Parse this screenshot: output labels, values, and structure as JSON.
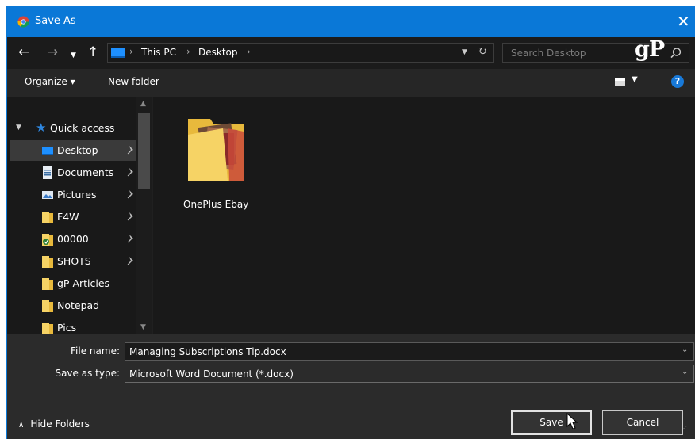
{
  "window": {
    "title": "Save As",
    "app_icon": "chrome-icon",
    "close_icon": "close-icon"
  },
  "nav": {
    "back_icon": "back-arrow-icon",
    "forward_icon": "forward-arrow-icon",
    "recent_icon": "chevron-down-icon",
    "up_icon": "up-arrow-icon",
    "breadcrumbs": [
      "This PC",
      "Desktop"
    ],
    "separator": "›",
    "refresh_icon": "refresh-icon",
    "search_placeholder": "Search Desktop",
    "watermark": "gP"
  },
  "toolbar": {
    "organize_label": "Organize ▾",
    "new_folder_label": "New folder",
    "help_label": "?"
  },
  "sidebar": {
    "quick_access_label": "Quick access",
    "items": [
      {
        "label": "Desktop",
        "icon": "desktop-icon",
        "pinned": true,
        "selected": true
      },
      {
        "label": "Documents",
        "icon": "documents-icon",
        "pinned": true
      },
      {
        "label": "Pictures",
        "icon": "pictures-icon",
        "pinned": true
      },
      {
        "label": "F4W",
        "icon": "folder-icon",
        "pinned": true
      },
      {
        "label": "00000",
        "icon": "folder-sync-icon",
        "pinned": true
      },
      {
        "label": "SHOTS",
        "icon": "folder-icon",
        "pinned": true
      },
      {
        "label": "gP Articles",
        "icon": "folder-icon",
        "pinned": false
      },
      {
        "label": "Notepad",
        "icon": "folder-icon",
        "pinned": false
      },
      {
        "label": "Pics",
        "icon": "folder-icon",
        "pinned": false
      }
    ]
  },
  "content": {
    "items": [
      {
        "label": "OnePlus Ebay",
        "icon": "folder-with-images-icon"
      }
    ]
  },
  "form": {
    "file_name_label": "File name:",
    "file_name_value": "Managing Subscriptions Tip.docx",
    "save_as_type_label": "Save as type:",
    "save_as_type_value": "Microsoft Word Document (*.docx)"
  },
  "footer": {
    "hide_folders_label": "Hide Folders",
    "save_label": "Save",
    "cancel_label": "Cancel"
  },
  "colors": {
    "accent": "#0a78d7",
    "window_bg": "#202020",
    "folder_yellow": "#f6d365"
  }
}
